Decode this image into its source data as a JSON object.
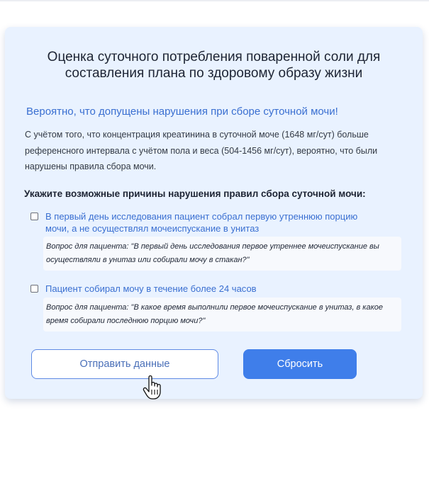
{
  "form": {
    "title": "Оценка суточного потребления поваренной соли для составления плана по здоровому образу жизни",
    "warning": "Вероятно, что допущены нарушения при сборе суточной мочи!",
    "explanation": "С учётом того, что концентрация креатинина в суточной моче (1648 мг/сут) больше референсного интервала с учётом пола и веса (504-1456 мг/сут), вероятно, что были нарушены правила сбора мочи.",
    "question": "Укажите возможные причины нарушения правил сбора суточной мочи:",
    "options": [
      {
        "label": "В первый день исследования пациент собрал первую утреннюю порцию мочи, а не осуществлял мочеиспускание в унитаз",
        "checked": false,
        "hint": "Вопрос для пациента: \"В первый день исследования первое утреннее мочеиспускание вы осуществляли в унитаз или собирали мочу в стакан?\""
      },
      {
        "label": "Пациент собирал мочу в течение более 24 часов",
        "checked": false,
        "hint": "Вопрос для пациента: \"В какое время выполнили первое мочеиспускание в унитаз, в какое время собирали последнюю порцию мочи?\""
      }
    ],
    "buttons": {
      "submit_label": "Отправить данные",
      "reset_label": "Сбросить"
    }
  },
  "colors": {
    "card_background": "#e9f2ff",
    "accent_blue": "#3f7eea",
    "link_blue": "#3a6fd1"
  },
  "cursor_icon": "hand-pointer-icon"
}
